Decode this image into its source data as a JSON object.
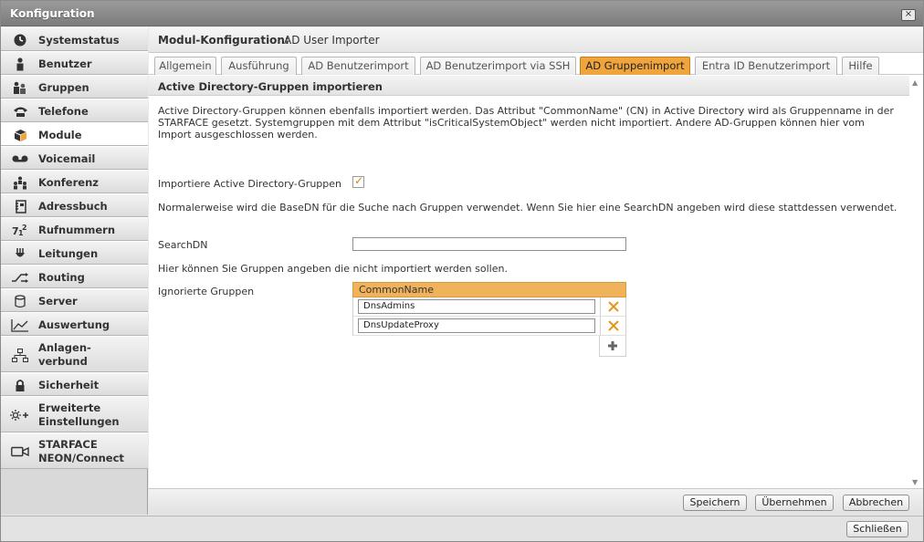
{
  "window": {
    "title": "Konfiguration",
    "close_symbol": "×"
  },
  "sidebar": {
    "items": [
      {
        "label": "Systemstatus",
        "icon": "gauge-icon"
      },
      {
        "label": "Benutzer",
        "icon": "user-icon"
      },
      {
        "label": "Gruppen",
        "icon": "group-icon"
      },
      {
        "label": "Telefone",
        "icon": "phone-icon"
      },
      {
        "label": "Module",
        "icon": "cube-icon",
        "active": true
      },
      {
        "label": "Voicemail",
        "icon": "voicemail-icon"
      },
      {
        "label": "Konferenz",
        "icon": "conference-icon"
      },
      {
        "label": "Adressbuch",
        "icon": "address-book-icon"
      },
      {
        "label": "Rufnummern",
        "icon": "number-icon"
      },
      {
        "label": "Leitungen",
        "icon": "lines-icon"
      },
      {
        "label": "Routing",
        "icon": "routing-icon"
      },
      {
        "label": "Server",
        "icon": "server-icon"
      },
      {
        "label": "Auswertung",
        "icon": "chart-icon"
      },
      {
        "label": "Anlagen-verbund",
        "line1": "Anlagen-",
        "line2": "verbund",
        "icon": "network-icon"
      },
      {
        "label": "Sicherheit",
        "icon": "lock-icon"
      },
      {
        "label": "Erweiterte Einstellungen",
        "line1": "Erweiterte",
        "line2": "Einstellungen",
        "icon": "settings-plus-icon"
      },
      {
        "label": "STARFACE NEON/Connect",
        "line1": "STARFACE",
        "line2": "NEON/Connect",
        "icon": "camera-icon"
      }
    ]
  },
  "module": {
    "key": "Modul-Konfiguration:",
    "value": "AD User Importer"
  },
  "tabs": [
    {
      "label": "Allgemein"
    },
    {
      "label": "Ausführung"
    },
    {
      "label": "AD Benutzerimport"
    },
    {
      "label": "AD Benutzerimport via SSH"
    },
    {
      "label": "AD Gruppenimport",
      "active": true
    },
    {
      "label": "Entra ID Benutzerimport"
    },
    {
      "label": "Hilfe"
    }
  ],
  "section": {
    "title": "Active Directory-Gruppen importieren",
    "intro": "Active Directory-Gruppen können ebenfalls importiert werden. Das Attribut \"CommonName\" (CN) in Active Directory wird als Gruppenname in der STARFACE gesetzt. Systemgruppen mit dem Attribut \"isCriticalSystemObject\" werden nicht importiert. Andere AD-Gruppen können hier vom Import ausgeschlossen werden.",
    "import_label": "Importiere Active Directory-Gruppen",
    "import_checked": true,
    "basedn_text": "Normalerweise wird die BaseDN für die Suche nach Gruppen verwendet. Wenn Sie hier eine SearchDN angeben wird diese stattdessen verwendet.",
    "searchdn_label": "SearchDN",
    "searchdn_value": "",
    "ignored_text": "Hier können Sie Gruppen angeben die nicht importiert werden sollen.",
    "ignored_label": "Ignorierte Gruppen",
    "grid_header": "CommonName",
    "ignored_groups": [
      "DnsAdmins",
      "DnsUpdateProxy"
    ]
  },
  "footer": {
    "save": "Speichern",
    "apply": "Übernehmen",
    "cancel": "Abbrechen"
  },
  "bottom": {
    "close": "Schließen"
  },
  "colors": {
    "accent": "#f0a53c",
    "delete": "#e8951c"
  }
}
